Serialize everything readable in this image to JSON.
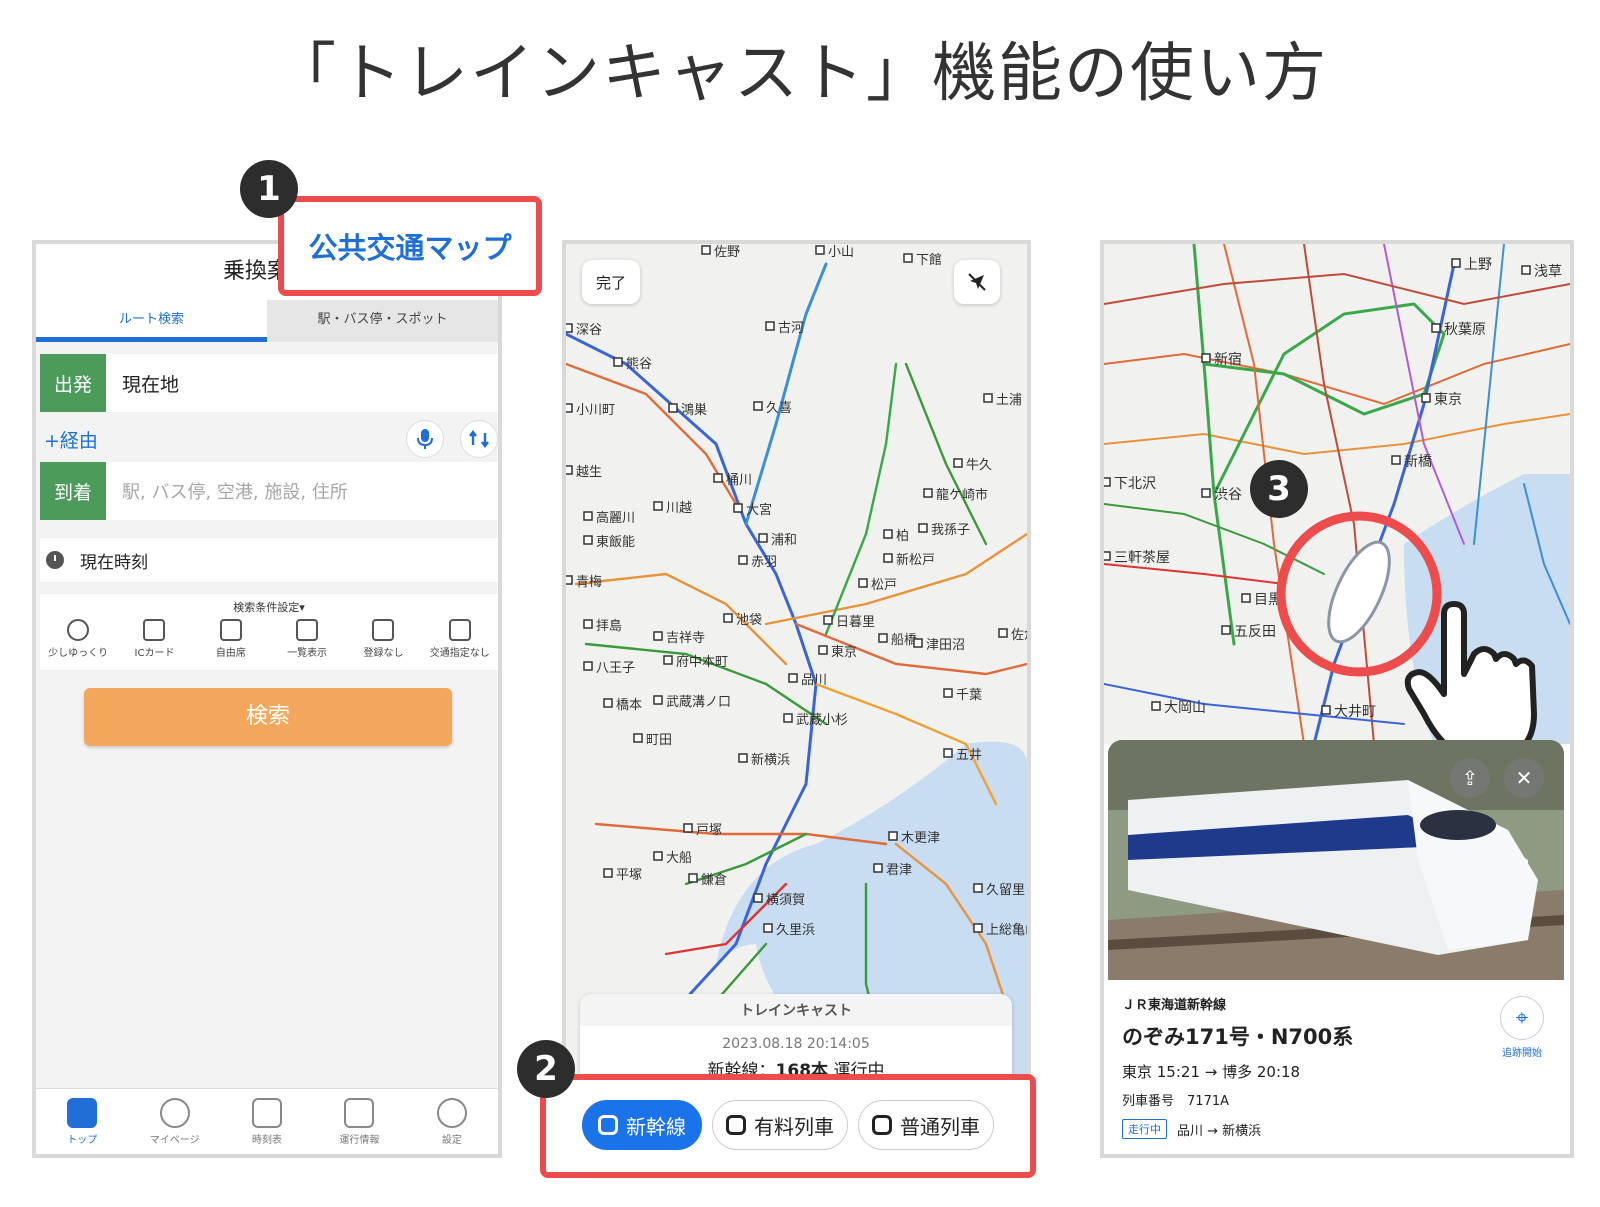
{
  "page_title": "「トレインキャスト」機能の使い方",
  "step1": {
    "badge": "1",
    "callout_label": "公共交通マップ",
    "header_title": "乗換案内",
    "tabs": [
      "ルート検索",
      "駅・バス停・スポット"
    ],
    "departure_label": "出発",
    "departure_value": "現在地",
    "via_link": "+経由",
    "arrival_label": "到着",
    "arrival_placeholder": "駅, バス停, 空港, 施設, 住所",
    "time_label": "現在時刻",
    "conditions_title": "検索条件設定▾",
    "conditions": [
      "少しゆっくり",
      "ICカード",
      "自由席",
      "一覧表示",
      "登録なし",
      "交通指定なし"
    ],
    "search_button": "検索",
    "tabbar": [
      "トップ",
      "マイページ",
      "時刻表",
      "運行情報",
      "設定"
    ]
  },
  "step2": {
    "badge": "2",
    "done_button": "完了",
    "map_labels": [
      "佐野",
      "小山",
      "下館",
      "古河",
      "深谷",
      "熊谷",
      "小川町",
      "鴻巣",
      "久喜",
      "土浦",
      "越生",
      "桶川",
      "牛久",
      "大宮",
      "川越",
      "龍ケ崎市",
      "高麗川",
      "浦和",
      "東飯能",
      "我孫子",
      "赤羽",
      "柏",
      "新松戸",
      "青梅",
      "松戸",
      "拝島",
      "池袋",
      "日暮里",
      "吉祥寺",
      "船橋",
      "津田沼",
      "八王子",
      "府中本町",
      "東京",
      "佐倉",
      "橋本",
      "武蔵溝ノ口",
      "品川",
      "千葉",
      "町田",
      "武蔵小杉",
      "新横浜",
      "五井",
      "戸塚",
      "大船",
      "木更津",
      "君津",
      "平塚",
      "鎌倉",
      "横須賀",
      "久留里",
      "久里浜",
      "上総亀山"
    ],
    "card_title": "トレインキャスト",
    "card_datetime": "2023.08.18 20:14:05",
    "card_status_prefix": "新幹線：",
    "card_status_count": "168本",
    "card_status_suffix": " 運行中",
    "filter_buttons": [
      "新幹線",
      "有料列車",
      "普通列車"
    ],
    "active_filter": "新幹線"
  },
  "step3": {
    "badge": "3",
    "map_labels": [
      "上野",
      "浅草",
      "秋葉原",
      "新宿",
      "東京",
      "新橋",
      "渋谷",
      "下北沢",
      "三軒茶屋",
      "目黒",
      "五反田",
      "大岡山",
      "大井町"
    ],
    "line_name": "ＪＲ東海道新幹線",
    "train_name": "のぞみ171号・N700系",
    "route": "東京 15:21 → 博多 20:18",
    "train_number_label": "列車番号",
    "train_number": "7171A",
    "status_badge": "走行中",
    "section": "品川 → 新横浜",
    "track_button": "追跡開始"
  },
  "colors": {
    "callout_red": "#ec4c4c",
    "accent_blue": "#1f6fd6",
    "search_orange": "#f3a75c",
    "label_green": "#4c9b5b",
    "badge_dark": "#2d2d2d"
  }
}
